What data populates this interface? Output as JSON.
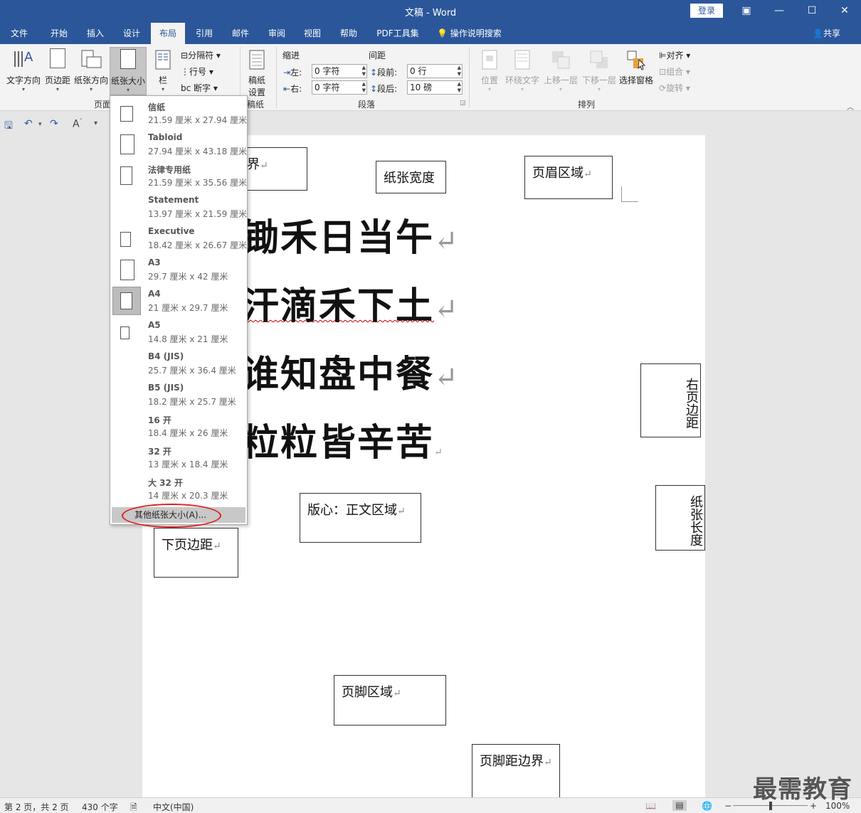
{
  "window": {
    "title": "文稿 - Word",
    "login": "登录",
    "controls": [
      "▣",
      "—",
      "☐",
      "✕"
    ]
  },
  "tabs": [
    "文件",
    "开始",
    "插入",
    "设计",
    "布局",
    "引用",
    "邮件",
    "审阅",
    "视图",
    "帮助",
    "PDF工具集"
  ],
  "active_tab": "布局",
  "tell_me": "操作说明搜索",
  "share": "共享",
  "ribbon": {
    "page_setup": {
      "buttons": [
        "文字方向",
        "页边距",
        "纸张方向",
        "纸张大小",
        "栏"
      ],
      "small": [
        "分隔符",
        "行号",
        "断字"
      ],
      "label": "页面"
    },
    "manuscript": {
      "button_line1": "稿纸",
      "button_line2": "设置",
      "label": "稿纸"
    },
    "paragraph": {
      "indent_header": "缩进",
      "spacing_header": "间距",
      "left_label": "左:",
      "right_label": "右:",
      "left_value": "0 字符",
      "right_value": "0 字符",
      "before_label": "段前:",
      "after_label": "段后:",
      "before_value": "0 行",
      "after_value": "10 磅",
      "label": "段落"
    },
    "arrange": {
      "buttons": [
        "位置",
        "环绕文字",
        "上移一层",
        "下移一层",
        "选择窗格"
      ],
      "small": [
        "对齐",
        "组合",
        "旋转"
      ],
      "label": "排列"
    }
  },
  "paper_menu": {
    "items": [
      {
        "name": "信纸",
        "dims": "21.59 厘米 x 27.94 厘米"
      },
      {
        "name": "Tabloid",
        "dims": "27.94 厘米 x 43.18 厘米"
      },
      {
        "name": "法律专用纸",
        "dims": "21.59 厘米 x 35.56 厘米"
      },
      {
        "name": "Statement",
        "dims": "13.97 厘米 x 21.59 厘米"
      },
      {
        "name": "Executive",
        "dims": "18.42 厘米 x 26.67 厘米"
      },
      {
        "name": "A3",
        "dims": "29.7 厘米 x 42 厘米"
      },
      {
        "name": "A4",
        "dims": "21 厘米 x 29.7 厘米"
      },
      {
        "name": "A5",
        "dims": "14.8 厘米 x 21 厘米"
      },
      {
        "name": "B4 (JIS)",
        "dims": "25.7 厘米 x 36.4 厘米"
      },
      {
        "name": "B5 (JIS)",
        "dims": "18.2 厘米 x 25.7 厘米"
      },
      {
        "name": "16 开",
        "dims": "18.4 厘米 x 26 厘米"
      },
      {
        "name": "32 开",
        "dims": "13 厘米 x 18.4 厘米"
      },
      {
        "name": "大 32 开",
        "dims": "14 厘米 x 20.3 厘米"
      }
    ],
    "selected": "A4",
    "more": "其他纸张大小(A)..."
  },
  "document": {
    "boxes": {
      "top_margin_partial": "界",
      "paper_width": "纸张宽度",
      "header_area": "页眉区域",
      "right_margin": "右页边距",
      "paper_length": "纸张长度",
      "body_area": "版心：正文区域",
      "bottom_margin": "下页边距",
      "footer_area": "页脚区域",
      "footer_distance": "页脚距边界"
    },
    "poem_lines": [
      "锄禾日当午",
      "汗滴禾下土",
      "谁知盘中餐",
      "粒粒皆辛苦"
    ],
    "paragraph_mark": "↵"
  },
  "status": {
    "page": "第 2 页，共 2 页",
    "words": "430 个字",
    "language": "中文(中国)",
    "zoom": "100%",
    "zoom_minus": "−",
    "zoom_plus": "+"
  },
  "watermark": "最需教育",
  "colors": {
    "accent": "#2b579a",
    "highlight_oval": "#e02020"
  }
}
